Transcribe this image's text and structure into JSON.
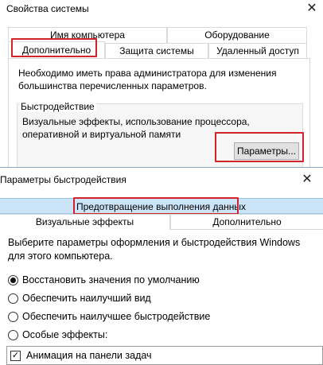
{
  "window_top": {
    "title": "Свойства системы",
    "close_glyph": "✕",
    "tabs_row_back": [
      "Имя компьютера",
      "Оборудование"
    ],
    "tabs_row_front": [
      "Дополнительно",
      "Защита системы",
      "Удаленный доступ"
    ],
    "admin_note": "Необходимо иметь права администратора для изменения большинства перечисленных параметров.",
    "performance_group": {
      "title": "Быстродействие",
      "description": "Визуальные эффекты, использование процессора, оперативной и виртуальной памяти",
      "button_label": "Параметры..."
    }
  },
  "window_perf": {
    "title": "Параметры быстродействия",
    "close_glyph": "✕",
    "tab_top": "Предотвращение выполнения данных",
    "tabs": [
      "Визуальные эффекты",
      "Дополнительно"
    ],
    "intro": "Выберите параметры оформления и быстродействия Windows для этого компьютера.",
    "options": [
      {
        "label": "Восстановить значения по умолчанию",
        "selected": true
      },
      {
        "label": "Обеспечить наилучший вид",
        "selected": false
      },
      {
        "label": "Обеспечить наилучшее быстродействие",
        "selected": false
      },
      {
        "label": "Особые эффекты:",
        "selected": false
      }
    ],
    "checkbox_items": [
      {
        "label": "Анимация на панели задач",
        "checked": true
      }
    ]
  },
  "colors": {
    "highlight": "#d2232a",
    "tab_blue": "#cce4f7"
  }
}
